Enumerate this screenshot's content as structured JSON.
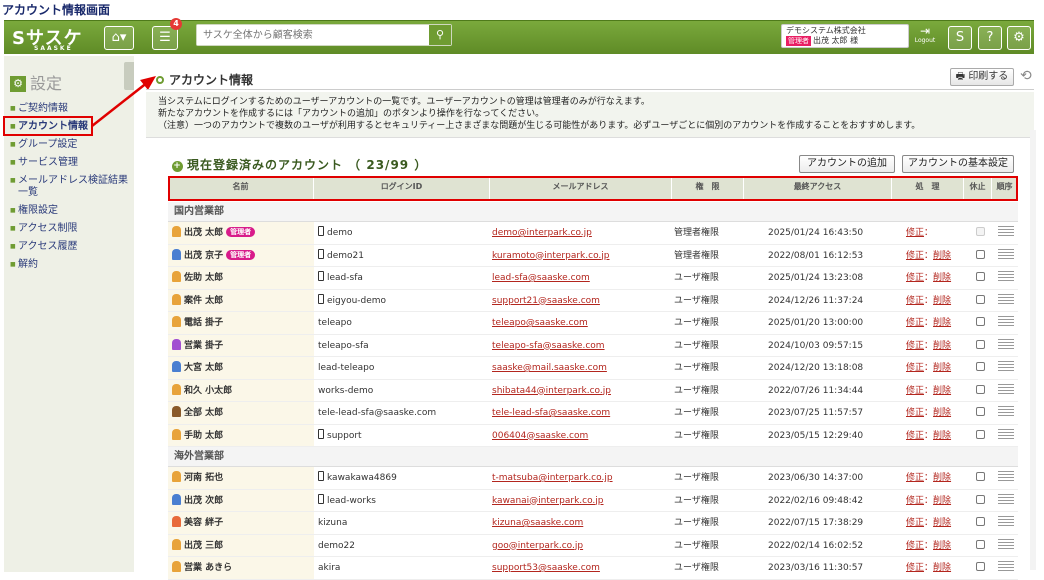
{
  "caption": "アカウント情報画面",
  "topbar": {
    "logo": "サスケ",
    "logo_sub": "SAASKE",
    "notification_count": "4",
    "search_placeholder": "サスケ全体から顧客検索",
    "company": "デモシステム株式会社",
    "role": "管理者",
    "user": "出茂 太郎 様",
    "logout": "Logout",
    "help": "?"
  },
  "sidebar": {
    "title": "設定",
    "items": [
      "ご契約情報",
      "アカウント情報",
      "グループ設定",
      "サービス管理",
      "メールアドレス検証結果一覧",
      "権限設定",
      "アクセス制限",
      "アクセス履歴",
      "解約"
    ]
  },
  "main": {
    "title": "アカウント情報",
    "print_label": "印刷する",
    "notice": [
      "当システムにログインするためのユーザーアカウントの一覧です。ユーザーアカウントの管理は管理者のみが行なえます。",
      "新たなアカウントを作成するには「アカウントの追加」のボタンより操作を行なってください。",
      "（注意）一つのアカウントで複数のユーザが利用するとセキュリティー上さまざまな問題が生じる可能性があります。必ずユーザごとに個別のアカウントを作成することをおすすめします。"
    ],
    "count_title": "現在登録済みのアカウント （ 23/99 ）",
    "add_button": "アカウントの追加",
    "settings_button": "アカウントの基本設定"
  },
  "table": {
    "headers": [
      "名前",
      "ログインID",
      "メールアドレス",
      "権　限",
      "最終アクセス",
      "処　理",
      "休止",
      "順序"
    ],
    "edit": "修正",
    "delete": "削除",
    "groups": [
      {
        "name": "国内営業部",
        "rows": [
          {
            "name": "出茂 太郎",
            "badge": "管理者",
            "login": "demo",
            "device": true,
            "email": "demo@interpark.co.jp",
            "auth": "管理者権限",
            "time": "2025/01/24 16:43:50",
            "deletable": false,
            "color": "#e8a33a"
          },
          {
            "name": "出茂 京子",
            "badge": "管理者",
            "login": "demo21",
            "device": true,
            "email": "kuramoto@interpark.co.jp",
            "auth": "管理者権限",
            "time": "2022/08/01 16:12:53",
            "deletable": true,
            "color": "#4a7fd1"
          },
          {
            "name": "佐助 太郎",
            "badge": "",
            "login": "lead-sfa",
            "device": true,
            "email": "lead-sfa@saaske.com",
            "auth": "ユーザ権限",
            "time": "2025/01/24 13:23:08",
            "deletable": true,
            "color": "#e8a33a"
          },
          {
            "name": "案件 太郎",
            "badge": "",
            "login": "eigyou-demo",
            "device": true,
            "email": "support21@saaske.com",
            "auth": "ユーザ権限",
            "time": "2024/12/26 11:37:24",
            "deletable": true,
            "color": "#e8a33a"
          },
          {
            "name": "電話 掛子",
            "badge": "",
            "login": "teleapo",
            "device": false,
            "email": "teleapo@saaske.com",
            "auth": "ユーザ権限",
            "time": "2025/01/20 13:00:00",
            "deletable": true,
            "color": "#e8a33a"
          },
          {
            "name": "営業 掛子",
            "badge": "",
            "login": "teleapo-sfa",
            "device": false,
            "email": "teleapo-sfa@saaske.com",
            "auth": "ユーザ権限",
            "time": "2024/10/03 09:57:15",
            "deletable": true,
            "color": "#a24fd1"
          },
          {
            "name": "大宮 太郎",
            "badge": "",
            "login": "lead-teleapo",
            "device": false,
            "email": "saaske@mail.saaske.com",
            "auth": "ユーザ権限",
            "time": "2024/12/20 13:18:08",
            "deletable": true,
            "color": "#4a7fd1"
          },
          {
            "name": "和久 小太郎",
            "badge": "",
            "login": "works-demo",
            "device": false,
            "email": "shibata44@interpark.co.jp",
            "auth": "ユーザ権限",
            "time": "2022/07/26 11:34:44",
            "deletable": true,
            "color": "#e8a33a"
          },
          {
            "name": "全部 太郎",
            "badge": "",
            "login": "tele-lead-sfa@saaske.com",
            "device": false,
            "email": "tele-lead-sfa@saaske.com",
            "auth": "ユーザ権限",
            "time": "2023/07/25 11:57:57",
            "deletable": true,
            "color": "#8a5a2a"
          },
          {
            "name": "手助 太郎",
            "badge": "",
            "login": "support",
            "device": true,
            "email": "006404@saaske.com",
            "auth": "ユーザ権限",
            "time": "2023/05/15 12:29:40",
            "deletable": true,
            "color": "#e8a33a"
          }
        ]
      },
      {
        "name": "海外営業部",
        "rows": [
          {
            "name": "河南 拓也",
            "badge": "",
            "login": "kawakawa4869",
            "device": true,
            "email": "t-matsuba@interpark.co.jp",
            "auth": "ユーザ権限",
            "time": "2023/06/30 14:37:00",
            "deletable": true,
            "color": "#e8a33a"
          },
          {
            "name": "出茂 次郎",
            "badge": "",
            "login": "lead-works",
            "device": true,
            "email": "kawanai@interpark.co.jp",
            "auth": "ユーザ権限",
            "time": "2022/02/16 09:48:42",
            "deletable": true,
            "color": "#4a7fd1"
          },
          {
            "name": "美容 絆子",
            "badge": "",
            "login": "kizuna",
            "device": false,
            "email": "kizuna@saaske.com",
            "auth": "ユーザ権限",
            "time": "2022/07/15 17:38:29",
            "deletable": true,
            "color": "#e86a3a"
          },
          {
            "name": "出茂 三郎",
            "badge": "",
            "login": "demo22",
            "device": false,
            "email": "goo@interpark.co.jp",
            "auth": "ユーザ権限",
            "time": "2022/02/14 16:02:52",
            "deletable": true,
            "color": "#e8a33a"
          },
          {
            "name": "営業 あきら",
            "badge": "",
            "login": "akira",
            "device": false,
            "email": "support53@saaske.com",
            "auth": "ユーザ権限",
            "time": "2023/03/16 11:30:57",
            "deletable": true,
            "color": "#e8a33a"
          }
        ]
      }
    ]
  }
}
